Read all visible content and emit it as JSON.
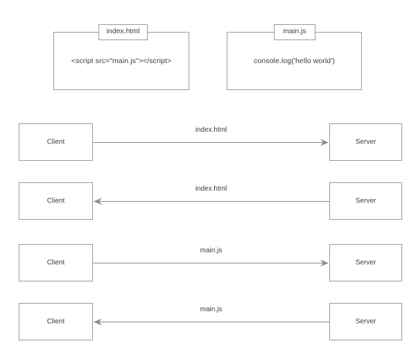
{
  "diagram": {
    "type": "sequence-flow",
    "files": [
      {
        "tab_label": "index.html",
        "code": "<script src=\"main.js\"></script>"
      },
      {
        "tab_label": "main.js",
        "code": "console.log('hello world')"
      }
    ],
    "exchanges": [
      {
        "source_label": "Client",
        "target_label": "Server",
        "edge_label": "index.html",
        "direction": "right"
      },
      {
        "source_label": "Client",
        "target_label": "Server",
        "edge_label": "index.html",
        "direction": "left"
      },
      {
        "source_label": "Client",
        "target_label": "Server",
        "edge_label": "main.js",
        "direction": "right"
      },
      {
        "source_label": "Client",
        "target_label": "Server",
        "edge_label": "main.js",
        "direction": "left"
      }
    ],
    "colors": {
      "stroke": "#9a9a9a",
      "arrow": "#8c8c8c",
      "text": "#3b3b3b",
      "background": "#ffffff"
    }
  }
}
